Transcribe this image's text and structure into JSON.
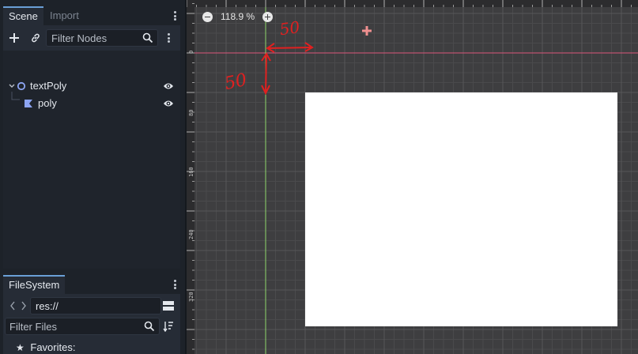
{
  "scene_dock": {
    "tabs": [
      {
        "label": "Scene",
        "active": true
      },
      {
        "label": "Import",
        "active": false
      }
    ],
    "filter_placeholder": "Filter Nodes",
    "tree": [
      {
        "label": "textPoly",
        "icon": "node2d-circle-icon",
        "visible": true,
        "expanded": true
      },
      {
        "label": "poly",
        "icon": "polygon2d-icon",
        "visible": true
      }
    ]
  },
  "filesystem_dock": {
    "tab_label": "FileSystem",
    "path": "res://",
    "filter_placeholder": "Filter Files",
    "favorites_label": "Favorites:"
  },
  "viewport": {
    "zoom_label": "118.9 %",
    "ruler_v_labels": [
      "0",
      "80",
      "160",
      "240",
      "320"
    ],
    "annotations": {
      "horizontal_label": "50",
      "vertical_label": "50"
    },
    "colors": {
      "background": "#3e3e40",
      "x_axis": "#d9557a",
      "y_axis": "#8fd66a",
      "annotation": "#e02020",
      "shape_fill": "#ffffff"
    }
  }
}
